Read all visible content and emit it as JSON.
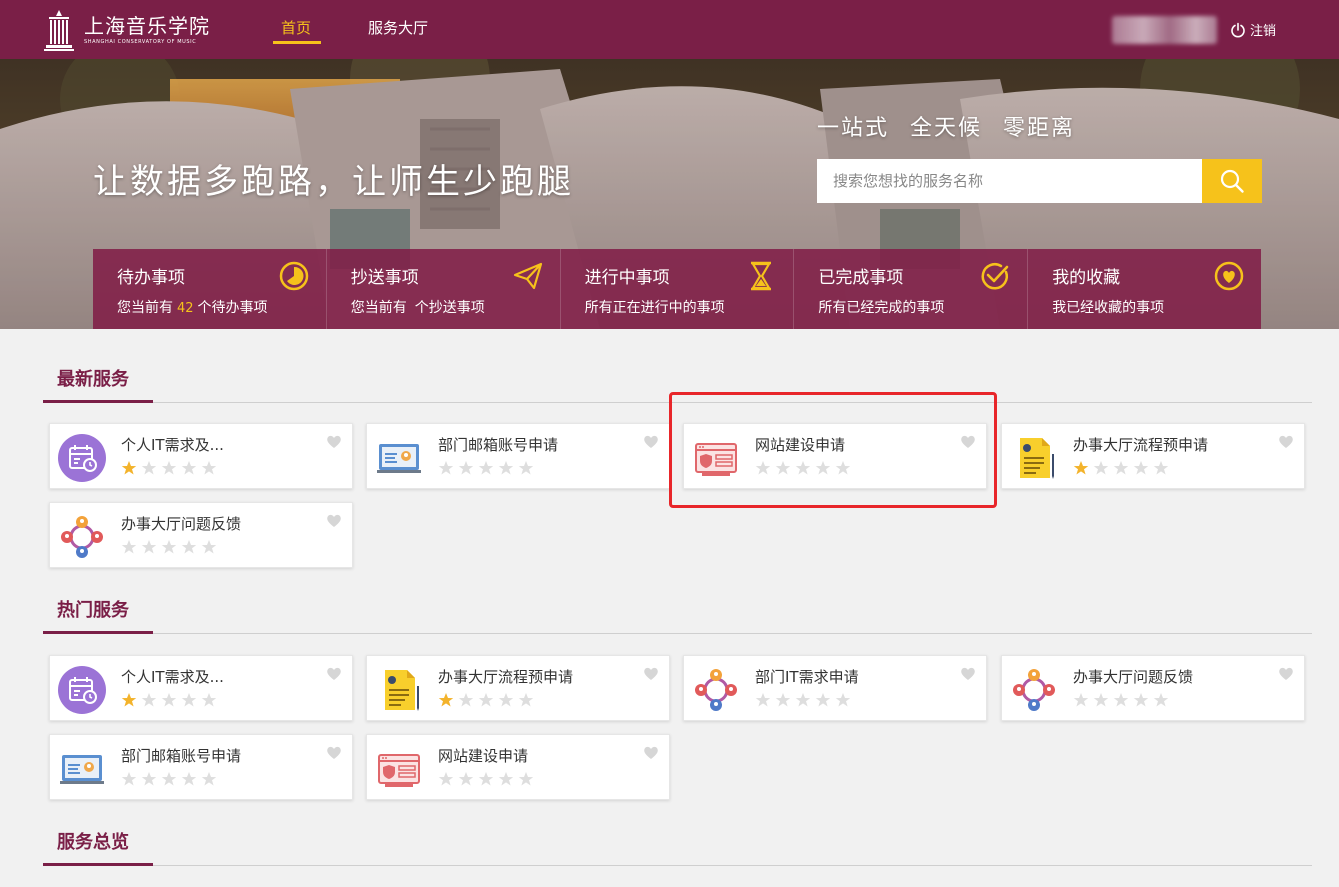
{
  "header": {
    "logo_cn": "上海音乐学院",
    "logo_en": "SHANGHAI CONSERVATORY OF MUSIC",
    "nav": [
      {
        "label": "首页",
        "active": true
      },
      {
        "label": "服务大厅",
        "active": false
      }
    ],
    "logout_label": "注销",
    "accent": "#f6c21b",
    "brand": "#7a1f47"
  },
  "hero": {
    "slogan": "让数据多跑路，让师生少跑腿",
    "tagline": "一站式 全天候 零距离",
    "search_placeholder": "搜索您想找的服务名称"
  },
  "quick_links": [
    {
      "title": "待办事项",
      "sub_prefix": "您当前有",
      "count": "42",
      "sub_suffix": "个待办事项",
      "icon": "clock-icon"
    },
    {
      "title": "抄送事项",
      "sub_prefix": "您当前有",
      "count": "",
      "sub_suffix": "个抄送事项",
      "icon": "paper-plane-icon"
    },
    {
      "title": "进行中事项",
      "sub": "所有正在进行中的事项",
      "icon": "hourglass-icon"
    },
    {
      "title": "已完成事项",
      "sub": "所有已经完成的事项",
      "icon": "check-circle-icon"
    },
    {
      "title": "我的收藏",
      "sub": "我已经收藏的事项",
      "icon": "heart-circle-icon"
    }
  ],
  "sections": {
    "latest": {
      "title": "最新服务",
      "cards": [
        {
          "name": "个人IT需求及...",
          "icon": "calendar-icon",
          "rating": 1
        },
        {
          "name": "部门邮箱账号申请",
          "icon": "monitor-mail-icon",
          "rating": 0
        },
        {
          "name": "网站建设申请",
          "icon": "web-security-icon",
          "rating": 0
        },
        {
          "name": "办事大厅流程预申请",
          "icon": "document-icon",
          "rating": 1
        },
        {
          "name": "办事大厅问题反馈",
          "icon": "network-people-icon",
          "rating": 0
        }
      ]
    },
    "hot": {
      "title": "热门服务",
      "cards": [
        {
          "name": "个人IT需求及...",
          "icon": "calendar-icon",
          "rating": 1
        },
        {
          "name": "办事大厅流程预申请",
          "icon": "document-icon",
          "rating": 1
        },
        {
          "name": "部门IT需求申请",
          "icon": "network-people-icon",
          "rating": 0
        },
        {
          "name": "办事大厅问题反馈",
          "icon": "network-people-icon",
          "rating": 0
        },
        {
          "name": "部门邮箱账号申请",
          "icon": "monitor-mail-icon",
          "rating": 0
        },
        {
          "name": "网站建设申请",
          "icon": "web-security-icon",
          "rating": 0
        }
      ]
    },
    "overview": {
      "title": "服务总览"
    }
  }
}
